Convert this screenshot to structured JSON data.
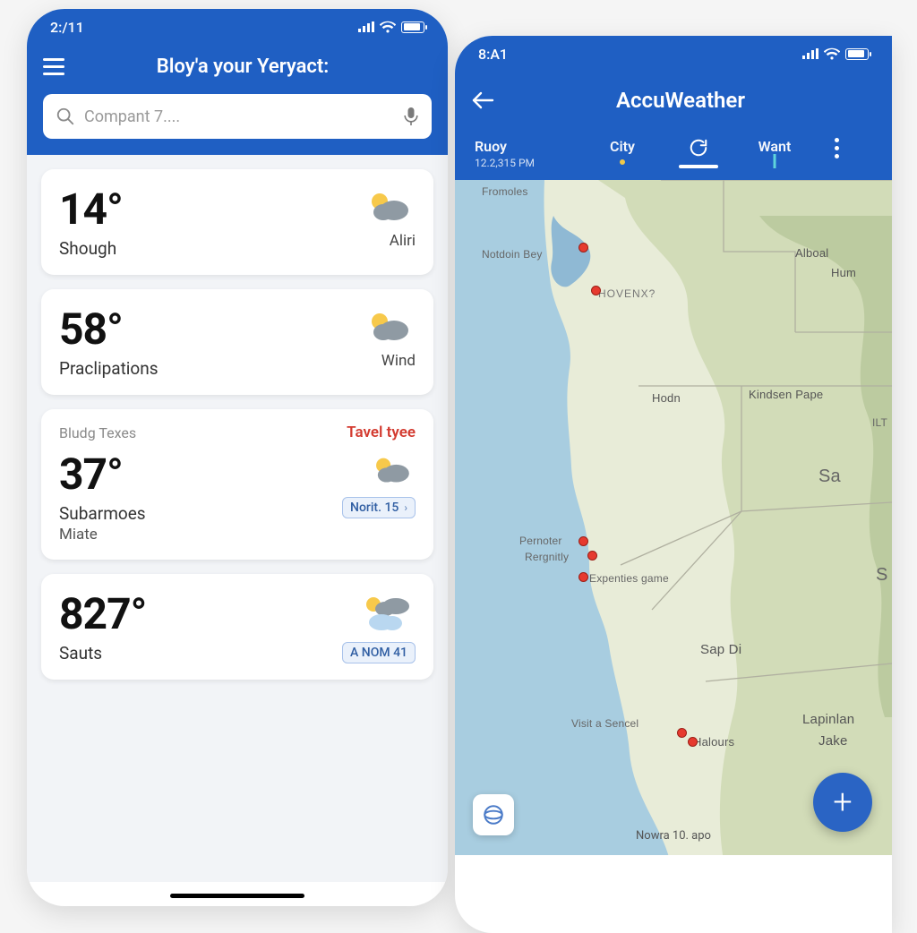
{
  "left": {
    "status_time": "2:/11",
    "title": "Bloy'a your Yeryact:",
    "search_placeholder": "Compant 7....",
    "cards": [
      {
        "temp": "14°",
        "label": "Shough",
        "icon_caption": "Aliri"
      },
      {
        "temp": "58°",
        "label": "Praclipations",
        "icon_caption": "Wind"
      },
      {
        "upper_left": "Bludg Texes",
        "upper_right": "Tavel tyee",
        "temp": "37°",
        "label": "Subarmoes",
        "label2": "Miate",
        "badge": "Norit. 15"
      },
      {
        "temp": "827°",
        "label": "Sauts",
        "badge": "A NOM 41"
      }
    ]
  },
  "right": {
    "status_time": "8:A1",
    "title": "AccuWeather",
    "tabs": {
      "t1": "Ruoy",
      "t1_sub": "12.2,315 PM",
      "t2": "City",
      "t4": "Want"
    },
    "map": {
      "labels": {
        "fromoles": "Fromoles",
        "notdoin": "Notdoin Bey",
        "hoven": "HOVENX?",
        "alboal": "Alboal",
        "hum": "Hum",
        "hodn": "Hodn",
        "kindsen": "Kindsen Pape",
        "ilt": "ILT",
        "sa": "Sa",
        "pernoter": "Pernoter",
        "rergnitly": "Rergnitly",
        "expenties": "Expenties game",
        "s": "S",
        "sapdi": "Sap Di",
        "visit": "Visit a Sencel",
        "halours": "Halours",
        "lapinian": "Lapinlan",
        "jake": "Jake",
        "footer": "Nowra 10. apo"
      }
    },
    "fab": "+"
  }
}
